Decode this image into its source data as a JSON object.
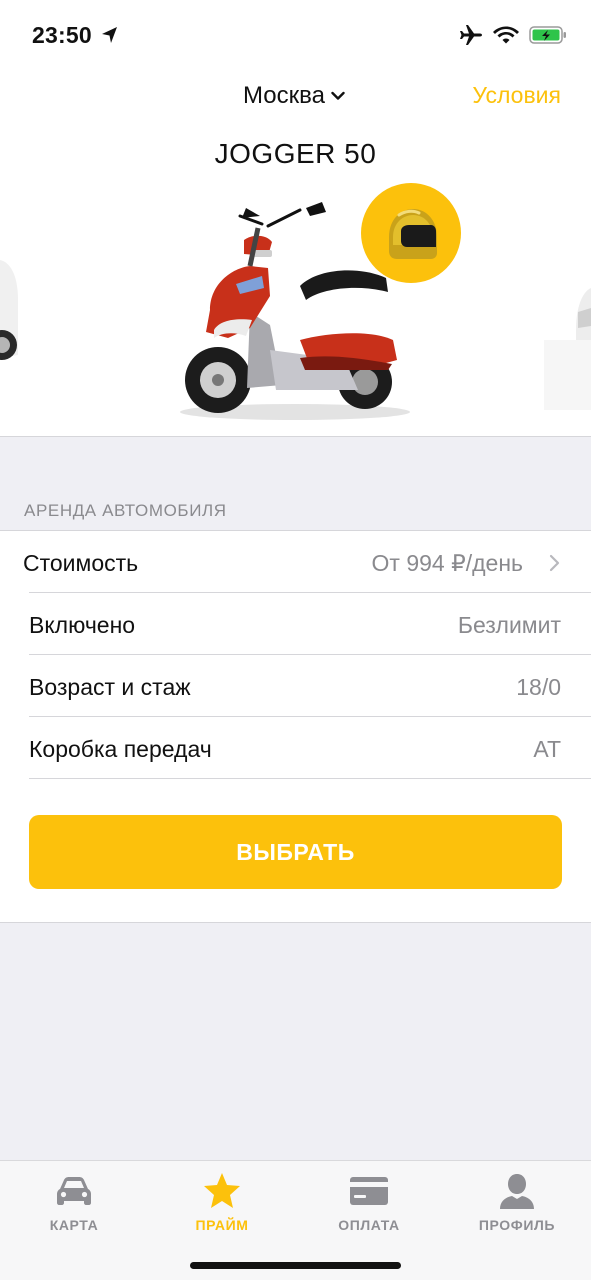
{
  "status_bar": {
    "time": "23:50",
    "icons": [
      "location-arrow-icon",
      "airplane-icon",
      "wifi-icon",
      "battery-charging-icon"
    ]
  },
  "header": {
    "city": "Москва",
    "city_icon": "chevron-down-icon",
    "terms_label": "Условия"
  },
  "vehicle": {
    "model": "JOGGER 50",
    "badge_icon": "helmet-icon"
  },
  "section": {
    "title": "АРЕНДА АВТОМОБИЛЯ"
  },
  "details": [
    {
      "label": "Стоимость",
      "value": "От 994 ₽/день",
      "has_chevron": true
    },
    {
      "label": "Включено",
      "value": "Безлимит"
    },
    {
      "label": "Возраст и стаж",
      "value": "18/0"
    },
    {
      "label": "Коробка передач",
      "value": "AT"
    }
  ],
  "select_button": {
    "label": "ВЫБРАТЬ"
  },
  "tabs": [
    {
      "label": "КАРТА",
      "icon": "car-icon",
      "active": false
    },
    {
      "label": "ПРАЙМ",
      "icon": "star-icon",
      "active": true
    },
    {
      "label": "ОПЛАТА",
      "icon": "card-icon",
      "active": false
    },
    {
      "label": "ПРОФИЛЬ",
      "icon": "person-icon",
      "active": false
    }
  ],
  "colors": {
    "accent": "#fcc10c",
    "scooter_body": "#c8301a",
    "inactive_tab": "#8e8e93",
    "background": "#efeff4"
  }
}
